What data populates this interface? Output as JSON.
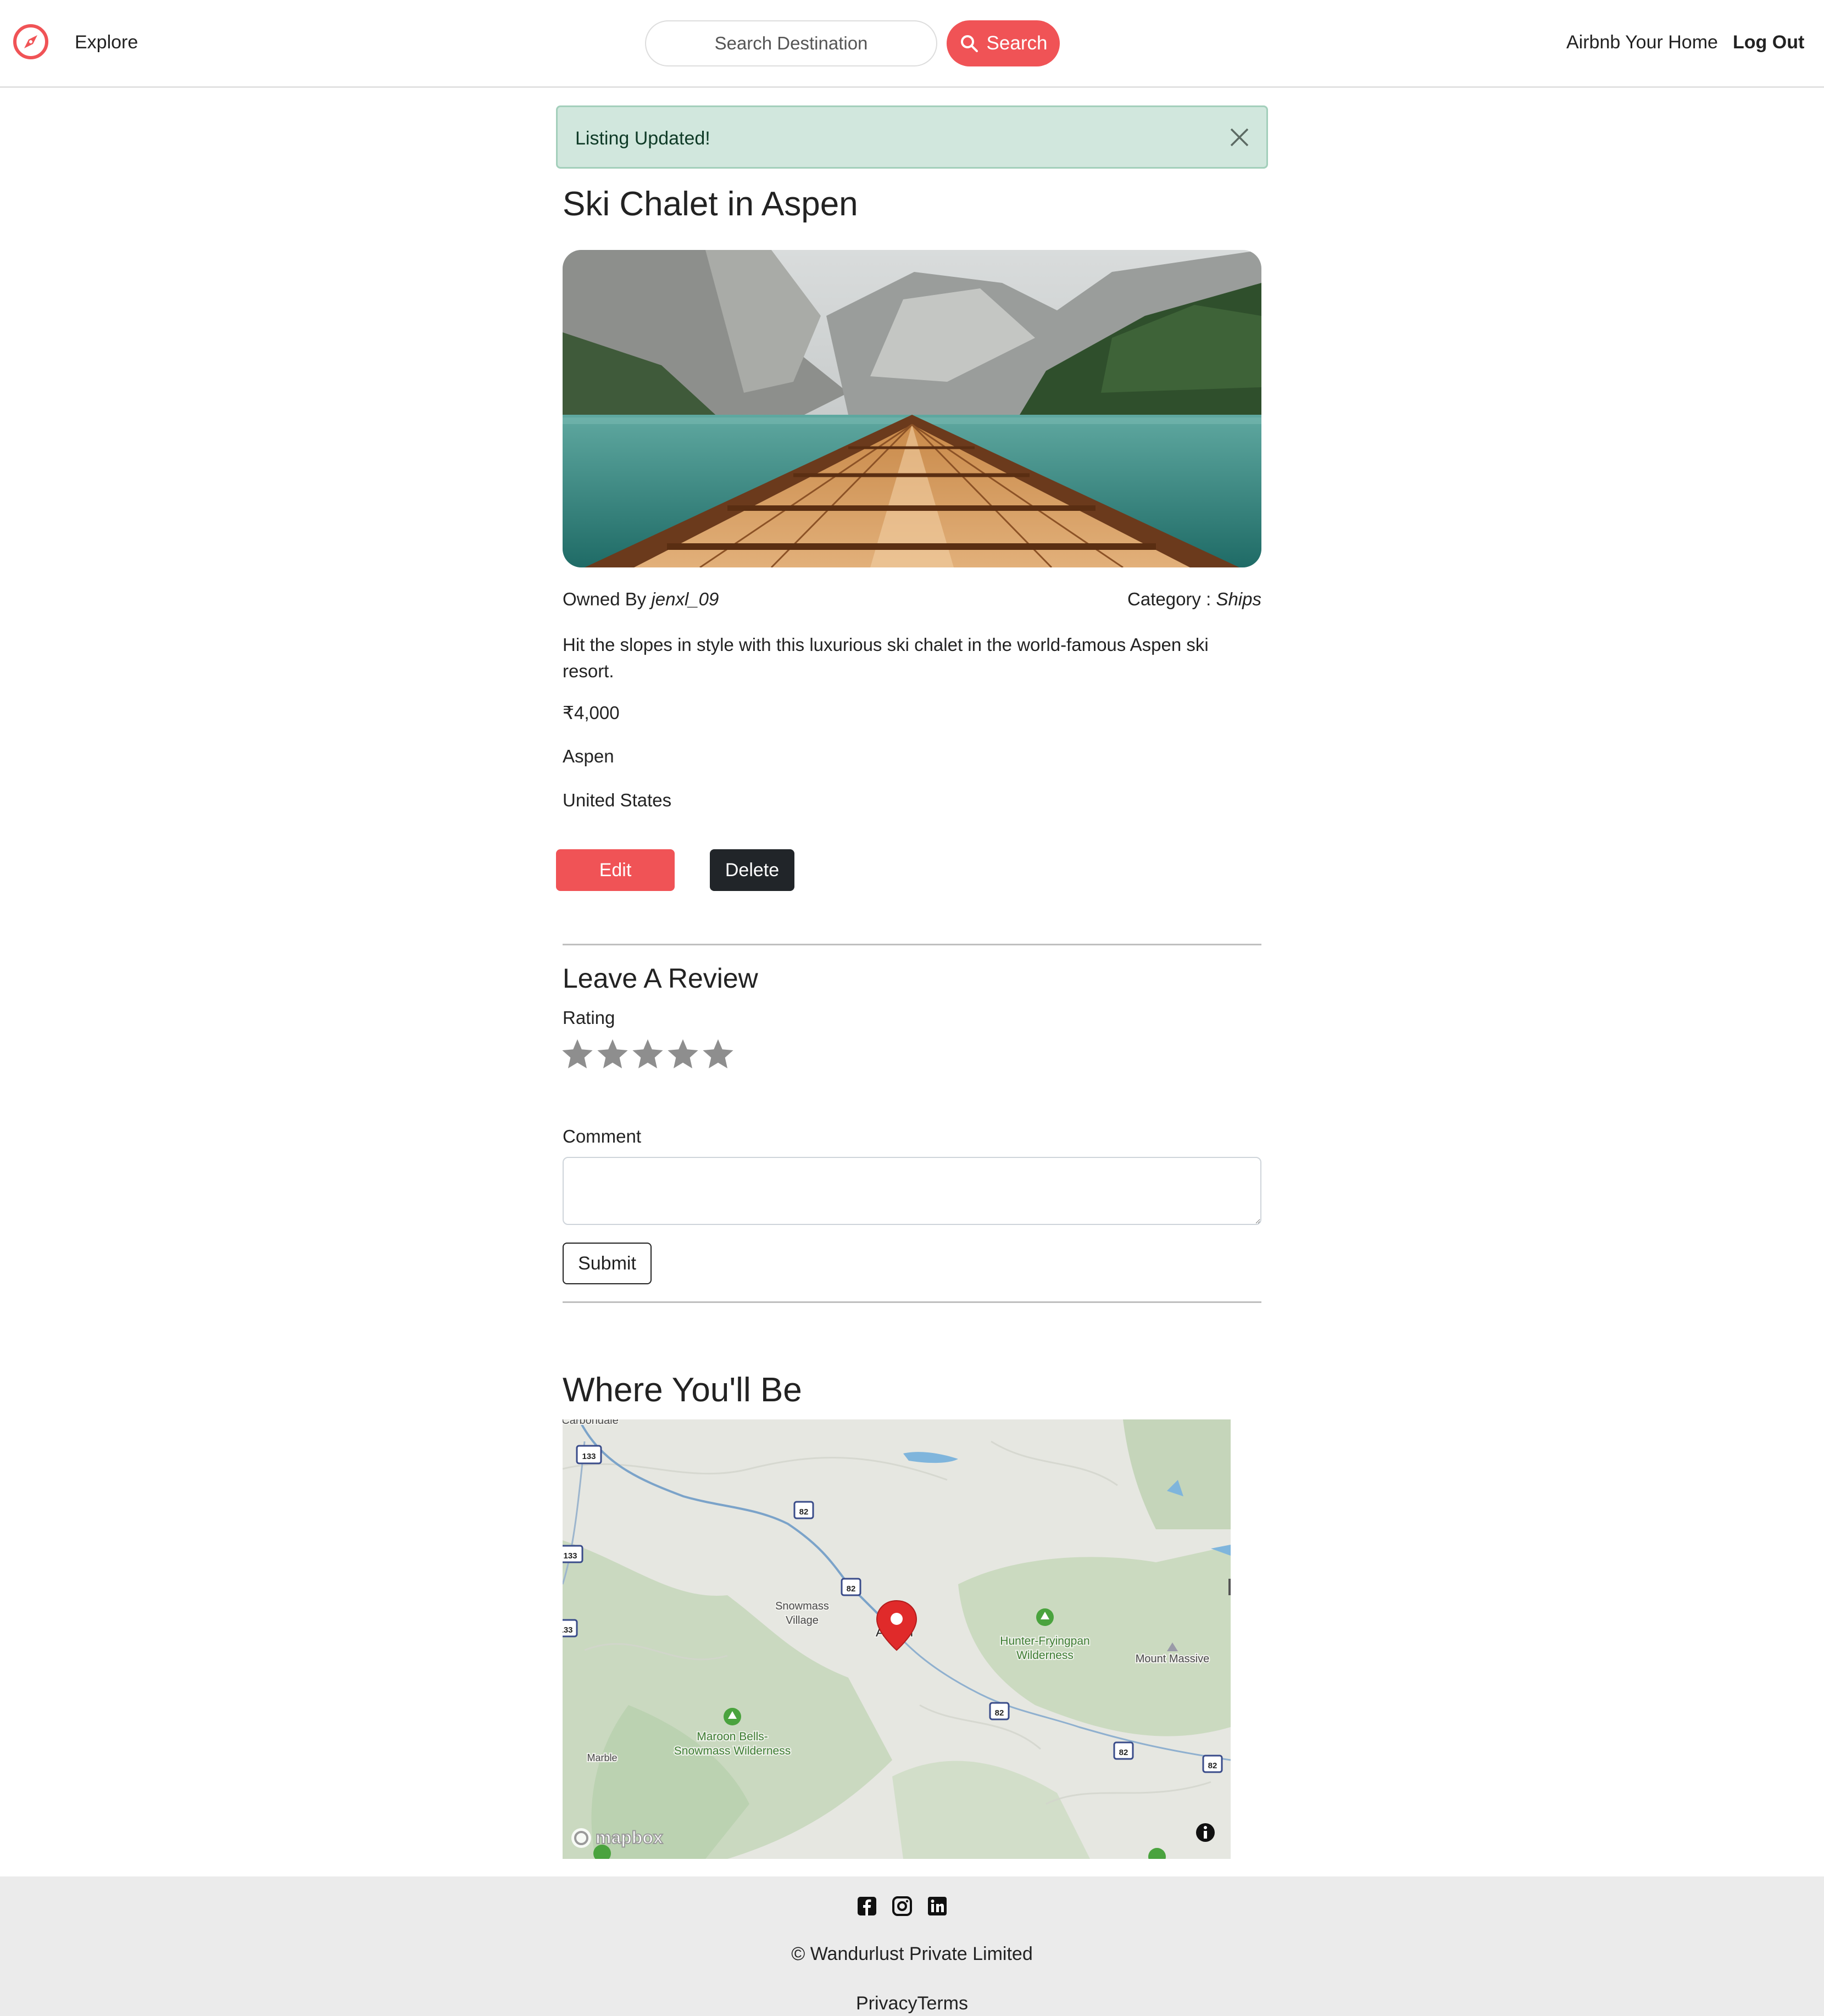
{
  "navbar": {
    "brand_icon": "compass-icon",
    "explore_label": "Explore",
    "search_placeholder": "Search Destination",
    "search_button_label": "Search",
    "host_label": "Airbnb Your Home",
    "logout_label": "Log Out",
    "accent_color": "#f05356"
  },
  "alert": {
    "message": "Listing Updated!",
    "close_icon": "close-icon",
    "background_color": "#d1e7dd"
  },
  "listing": {
    "title": "Ski Chalet in Aspen",
    "owned_by_label": "Owned By",
    "owner": "jenxl_09",
    "category_label": "Category :",
    "category": "Ships",
    "description": "Hit the slopes in style with this luxurious ski chalet in the world-famous Aspen ski resort.",
    "price": "₹4,000",
    "location": "Aspen",
    "country": "United States",
    "edit_label": "Edit",
    "delete_label": "Delete"
  },
  "review": {
    "heading": "Leave A Review",
    "rating_label": "Rating",
    "stars": 5,
    "selected_rating": 0,
    "comment_label": "Comment",
    "comment_value": "",
    "submit_label": "Submit"
  },
  "map": {
    "heading": "Where You'll Be",
    "marker_label": "Aspen",
    "attribution": "mapbox",
    "places": {
      "carbondale": "Carbondale",
      "snowmass_line1": "Snowmass",
      "snowmass_line2": "Village",
      "hunter_line1": "Hunter-Fryingpan",
      "hunter_line2": "Wilderness",
      "mount_massive": "Mount Massive",
      "maroon_line1": "Maroon Bells-",
      "maroon_line2": "Snowmass Wilderness",
      "marble": "Marble"
    },
    "highway_shields": [
      "133",
      "82"
    ]
  },
  "footer": {
    "social_icons": [
      "facebook-icon",
      "instagram-icon",
      "linkedin-icon"
    ],
    "copyright": "© Wandurlust Private Limited",
    "links": "PrivacyTerms"
  }
}
